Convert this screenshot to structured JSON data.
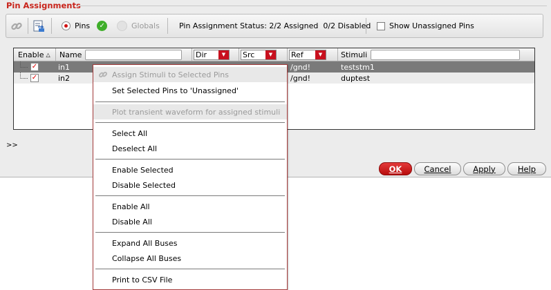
{
  "panel": {
    "title": "Pin Assignments"
  },
  "toolbar": {
    "pins_label": "Pins",
    "globals_label": "Globals",
    "status_text": "Pin Assignment Status: 2/2 Assigned  0/2 Disabled",
    "show_unassigned_label": "Show Unassigned Pins",
    "show_unassigned_checked": false,
    "mode": "Pins"
  },
  "table": {
    "headers": {
      "enable": "Enable",
      "name": "Name",
      "dir": "Dir",
      "src": "Src",
      "ref": "Ref",
      "stimuli": "Stimuli"
    },
    "sort_indicator": "△",
    "rows": [
      {
        "enabled": true,
        "name": "in1",
        "ref": "/gnd!",
        "stimuli": "teststm1",
        "selected": true
      },
      {
        "enabled": true,
        "name": "in2",
        "ref": "/gnd!",
        "stimuli": "duptest",
        "selected": false
      }
    ]
  },
  "expander": ">>",
  "buttons": {
    "ok": "OK",
    "cancel": "Cancel",
    "apply": "Apply",
    "help": "Help"
  },
  "context_menu": {
    "items": [
      {
        "label": "Assign Stimuli to Selected Pins",
        "enabled": false,
        "icon": "link-icon",
        "highlighted": true
      },
      {
        "label": "Set Selected Pins to 'Unassigned'",
        "enabled": true
      },
      {
        "label": "Plot transient waveform for assigned stimuli",
        "enabled": false
      },
      {
        "label": "Select All",
        "enabled": true
      },
      {
        "label": "Deselect All",
        "enabled": true
      },
      {
        "label": "Enable Selected",
        "enabled": true
      },
      {
        "label": "Disable Selected",
        "enabled": true
      },
      {
        "label": "Enable All",
        "enabled": true
      },
      {
        "label": "Disable All",
        "enabled": true
      },
      {
        "label": "Expand All Buses",
        "enabled": true
      },
      {
        "label": "Collapse All Buses",
        "enabled": true
      },
      {
        "label": "Print to CSV File",
        "enabled": true
      }
    ]
  },
  "colors": {
    "accent_red": "#c8101e",
    "title_red": "#c8241b",
    "status_green": "#3fae2a",
    "selection_gray": "#7a7a7a"
  }
}
